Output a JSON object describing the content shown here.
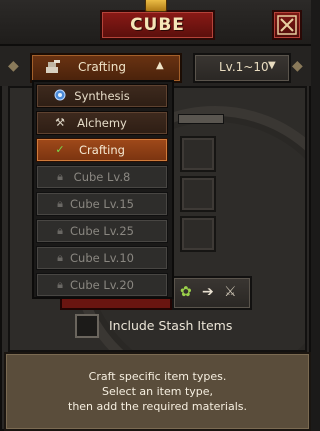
{
  "window": {
    "title": "CUBE"
  },
  "toolbar": {
    "craft_dropdown": {
      "label": "Crafting",
      "icon": "crafting-icon"
    },
    "level_dropdown": {
      "label": "Lv.1~10"
    }
  },
  "menu": {
    "items": [
      {
        "label": "Synthesis",
        "icon": "synthesis-orb-icon",
        "state": "normal"
      },
      {
        "label": "Alchemy",
        "icon": "alchemy-icon",
        "state": "normal"
      },
      {
        "label": "Crafting",
        "icon": "checkmark-icon",
        "state": "selected"
      },
      {
        "label": "Cube Lv.8",
        "icon": "lock-icon",
        "state": "locked"
      },
      {
        "label": "Cube Lv.15",
        "icon": "lock-icon",
        "state": "locked"
      },
      {
        "label": "Cube Lv.25",
        "icon": "lock-icon",
        "state": "locked"
      },
      {
        "label": "Cube Lv.10",
        "icon": "lock-icon",
        "state": "locked"
      },
      {
        "label": "Cube Lv.20",
        "icon": "lock-icon",
        "state": "locked"
      }
    ]
  },
  "stash": {
    "label": "Include Stash Items",
    "checked": false
  },
  "info": {
    "lines": [
      "Craft specific item types.",
      "Select an item type,",
      "then add the required materials."
    ]
  },
  "colors": {
    "title_red": "#8a1a16",
    "accent_orange": "#a04a1a",
    "info_panel": "#5a4d3b"
  }
}
